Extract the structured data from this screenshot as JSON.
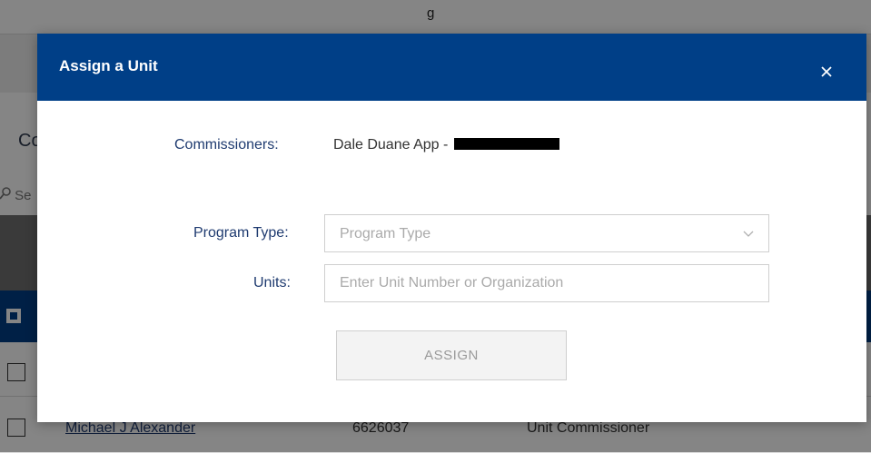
{
  "background": {
    "top_text": "g",
    "heading": "Co",
    "search_placeholder": "Se",
    "rows": [
      {
        "name": "",
        "id": "",
        "position": ""
      },
      {
        "name": "Michael J Alexander",
        "id": "6626037",
        "position": "Unit Commissioner"
      }
    ]
  },
  "modal": {
    "title": "Assign a Unit",
    "close_icon": "close-icon",
    "commissioners_label": "Commissioners:",
    "commissioners_value": "Dale Duane App -",
    "program_type_label": "Program Type:",
    "program_type_placeholder": "Program Type",
    "units_label": "Units:",
    "units_placeholder": "Enter Unit Number or Organization",
    "assign_label": "ASSIGN"
  },
  "colors": {
    "header_blue": "#003f87",
    "label_blue": "#1f3b70",
    "overlay": "rgba(0,0,0,0.48)"
  }
}
